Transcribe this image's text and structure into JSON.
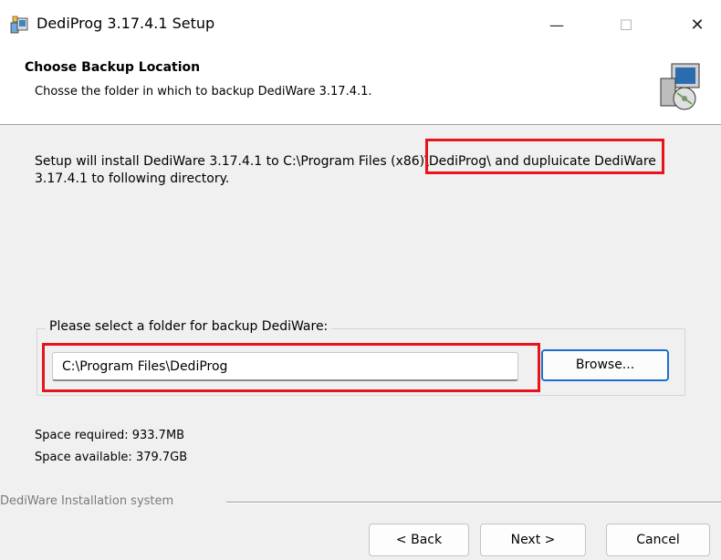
{
  "window": {
    "title": "DediProg 3.17.4.1 Setup",
    "controls": {
      "minimize": "—",
      "maximize": "☐",
      "close": "✕"
    }
  },
  "header": {
    "title": "Choose Backup Location",
    "subtitle": "Chosse the folder in which to backup DediWare 3.17.4.1."
  },
  "body": {
    "intro": "Setup will install DediWare 3.17.4.1 to C:\\Program Files (x86)\\DediProg\\ and dupluicate DediWare 3.17.4.1 to following directory."
  },
  "folder_group": {
    "label": "Please select a folder for backup DediWare:",
    "path_value": "C:\\Program Files\\DediProg",
    "browse_label": "Browse..."
  },
  "space": {
    "required": "Space required: 933.7MB",
    "available": "Space available: 379.7GB"
  },
  "footer": {
    "branding": "DediWare Installation system",
    "back_label": "< Back",
    "next_label": "Next >",
    "cancel_label": "Cancel"
  },
  "colors": {
    "highlight": "#e8141c",
    "focus_border": "#1a6fd0",
    "dialog_bg": "#f0f0f0"
  }
}
